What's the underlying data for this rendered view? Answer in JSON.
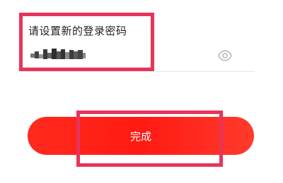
{
  "password_form": {
    "label": "请设置新的登录密码",
    "masked_value": "••••••",
    "visibility_icon": "eye-icon"
  },
  "submit": {
    "label": "完成"
  },
  "colors": {
    "button_red": "#ff1f16",
    "highlight_pink": "#e8345a",
    "divider": "#e6e6e6"
  }
}
